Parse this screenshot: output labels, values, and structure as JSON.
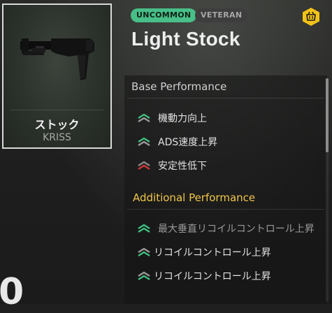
{
  "item_card": {
    "name": "ストック",
    "subtitle": "KRISS"
  },
  "header": {
    "rarity_badge": "UNCOMMON",
    "veteran_badge": "VETERAN",
    "title": "Light Stock",
    "shop_icon": "basket-icon"
  },
  "bottom_left_text": "0",
  "base_performance": {
    "title": "Base Performance",
    "items": [
      {
        "label": "機動力向上",
        "icon": "chevron-up-green-icon"
      },
      {
        "label": "ADS速度上昇",
        "icon": "chevron-up-green-icon"
      },
      {
        "label": "安定性低下",
        "icon": "chevron-down-red-icon"
      }
    ]
  },
  "additional_performance": {
    "title": "Additional Performance",
    "items": [
      {
        "label": "最大垂直リコイルコントロール上昇",
        "icon": "chevron-up-green-icon"
      },
      {
        "label": "リコイルコントロール上昇",
        "icon": "chevron-up-green-icon"
      },
      {
        "label": "リコイルコントロール上昇",
        "icon": "chevron-up-green-icon"
      }
    ]
  },
  "colors": {
    "rarity_green": "#48bf88",
    "accent_yellow": "#f0c64a",
    "stat_up": "#3fbf7f",
    "stat_down": "#d23a3a"
  },
  "scroll_position_fraction": 0.0
}
